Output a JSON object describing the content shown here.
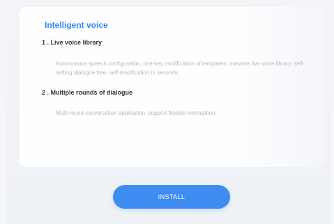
{
  "section_title": "Intelligent voice",
  "features": [
    {
      "heading": "1 . Live voice library",
      "description": "Autonomous speech configuration, one-key modification of templates; massive live voice library, self-setting dialogue tree, self-modification in seconds."
    },
    {
      "heading": "2 . Multiple rounds of dialogue",
      "description": "Multi-round conversation application, support flexible interruption."
    }
  ],
  "install_label": "INSTALL",
  "colors": {
    "accent": "#2f86ff",
    "button": "#3f8cf2"
  }
}
